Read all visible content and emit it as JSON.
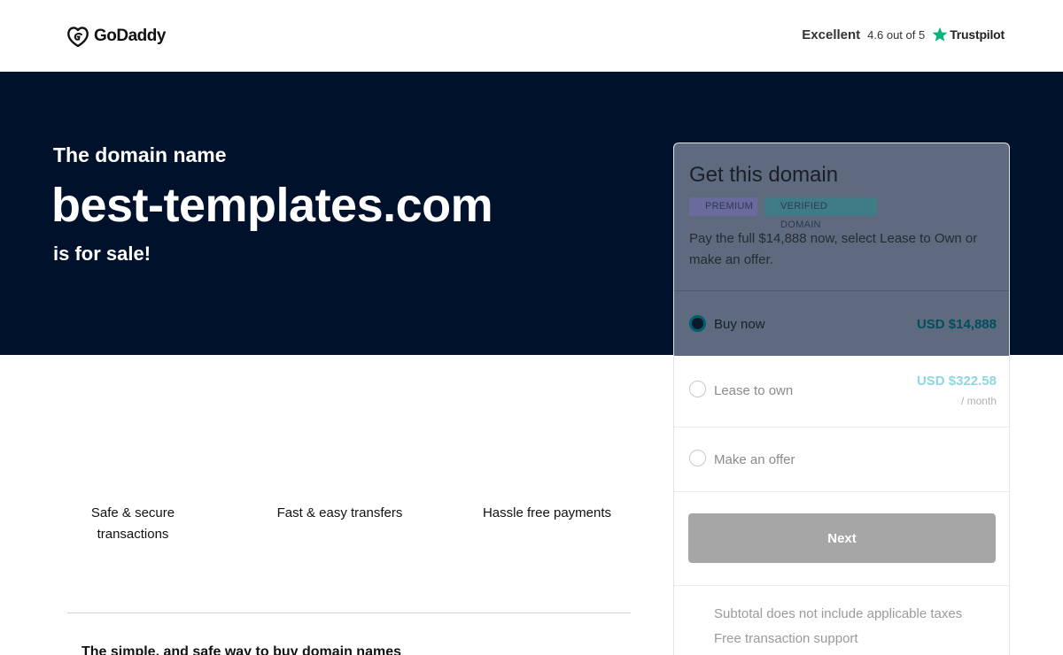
{
  "header": {
    "logo_text": "GoDaddy",
    "trustpilot": {
      "rating_word": "Excellent",
      "score_text": "4.6 out of 5",
      "brand": "Trustpilot",
      "star_color": "#00b67a"
    }
  },
  "hero": {
    "pre_title": "The domain name",
    "domain": "best-templates.com",
    "post_title": "is for sale!",
    "background_color": "#00112c"
  },
  "features": [
    {
      "label": "Safe & secure transactions"
    },
    {
      "label": "Fast & easy transfers"
    },
    {
      "label": "Hassle free payments"
    }
  ],
  "bottom_heading": "The simple, and safe way to buy domain names",
  "card": {
    "title": "Get this domain",
    "badges": [
      "PREMIUM",
      "VERIFIED DOMAIN"
    ],
    "description": "Pay the full $14,888 now, select Lease to Own or make an offer.",
    "options": [
      {
        "label": "Buy now",
        "price": "USD $14,888",
        "selected": true
      },
      {
        "label": "Lease to own",
        "price": "USD $322.58",
        "sub": "/ month",
        "selected": false
      },
      {
        "label": "Make an offer",
        "selected": false
      }
    ],
    "next_label": "Next",
    "notes": [
      "Subtotal does not include applicable taxes",
      "Free transaction support"
    ],
    "accent_color": "#005f6f"
  }
}
